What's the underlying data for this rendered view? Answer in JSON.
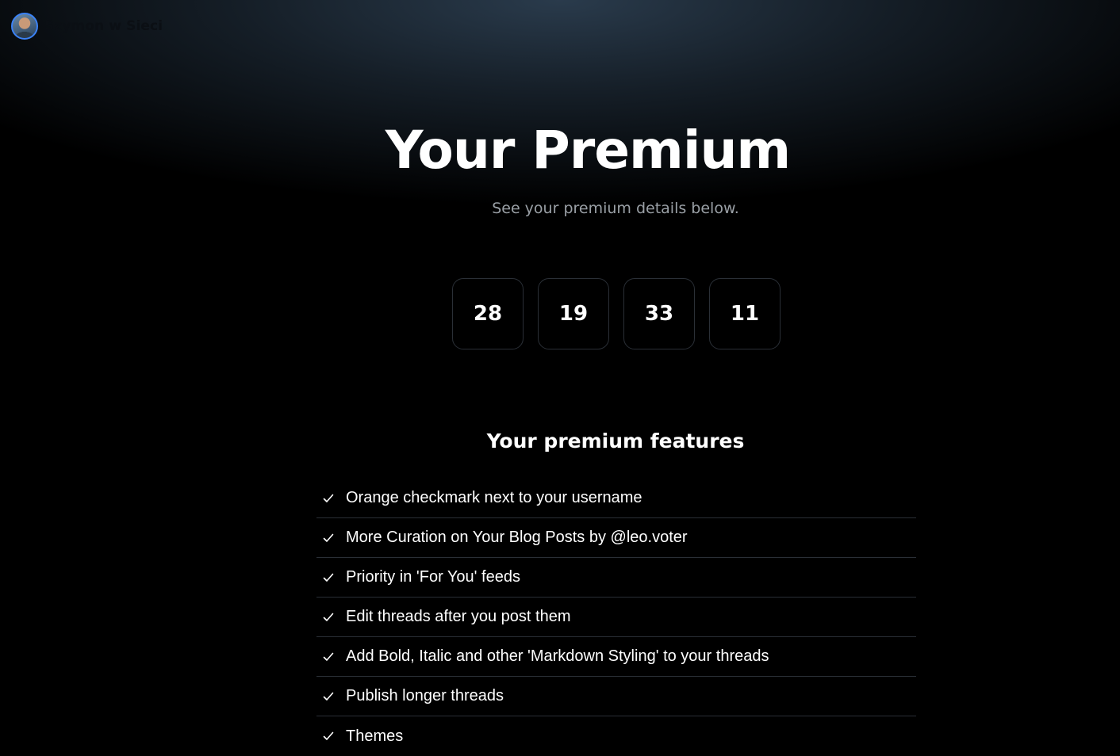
{
  "header": {
    "username": "Szymon w Sieci"
  },
  "hero": {
    "title": "Your Premium",
    "subtitle": "See your premium details below."
  },
  "countdown": [
    "28",
    "19",
    "33",
    "11"
  ],
  "features": {
    "title": "Your premium features",
    "items": [
      "Orange checkmark next to your username",
      "More Curation on Your Blog Posts by @leo.voter",
      "Priority in 'For You' feeds",
      "Edit threads after you post them",
      "Add Bold, Italic and other 'Markdown Styling' to your threads",
      "Publish longer threads",
      "Themes"
    ]
  },
  "colors": {
    "background": "#000000",
    "header_glow": "#2c3e50",
    "avatar_ring": "#3b82f6",
    "muted_text": "#9aa0a6",
    "divider": "#2a2f36"
  }
}
